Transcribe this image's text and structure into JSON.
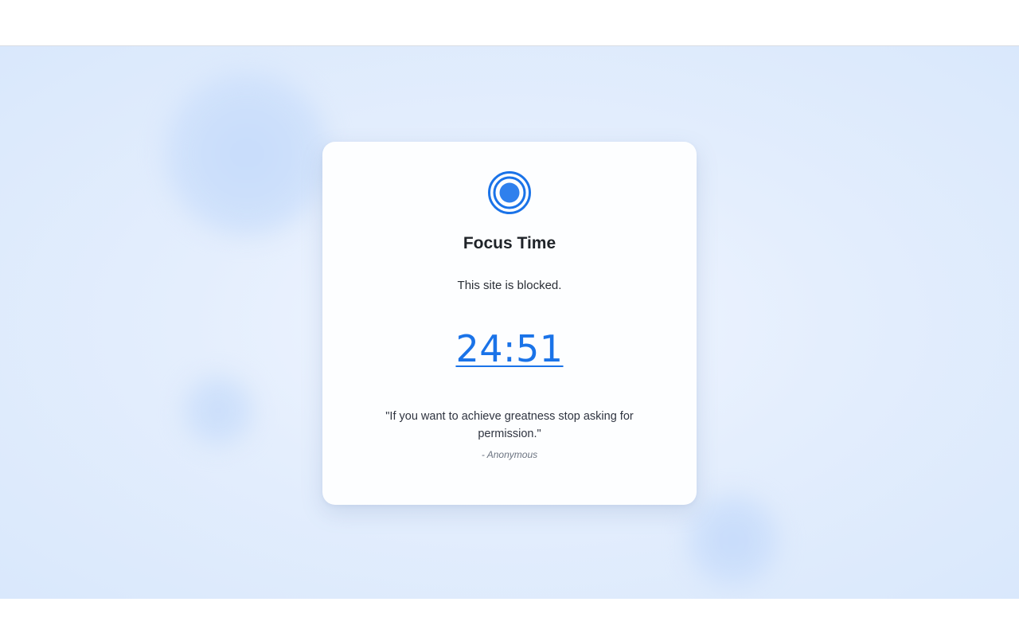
{
  "block_page": {
    "title": "Focus Time",
    "message": "This site is blocked.",
    "timer": "24:51",
    "quote": "\"If you want to achieve greatness stop asking for permission.\"",
    "author": "- Anonymous",
    "icon": "focus-target-icon"
  },
  "colors": {
    "accent": "#1a73e8",
    "background": "#e4eefd",
    "card": "#fdfeff",
    "title": "#1f2328"
  }
}
